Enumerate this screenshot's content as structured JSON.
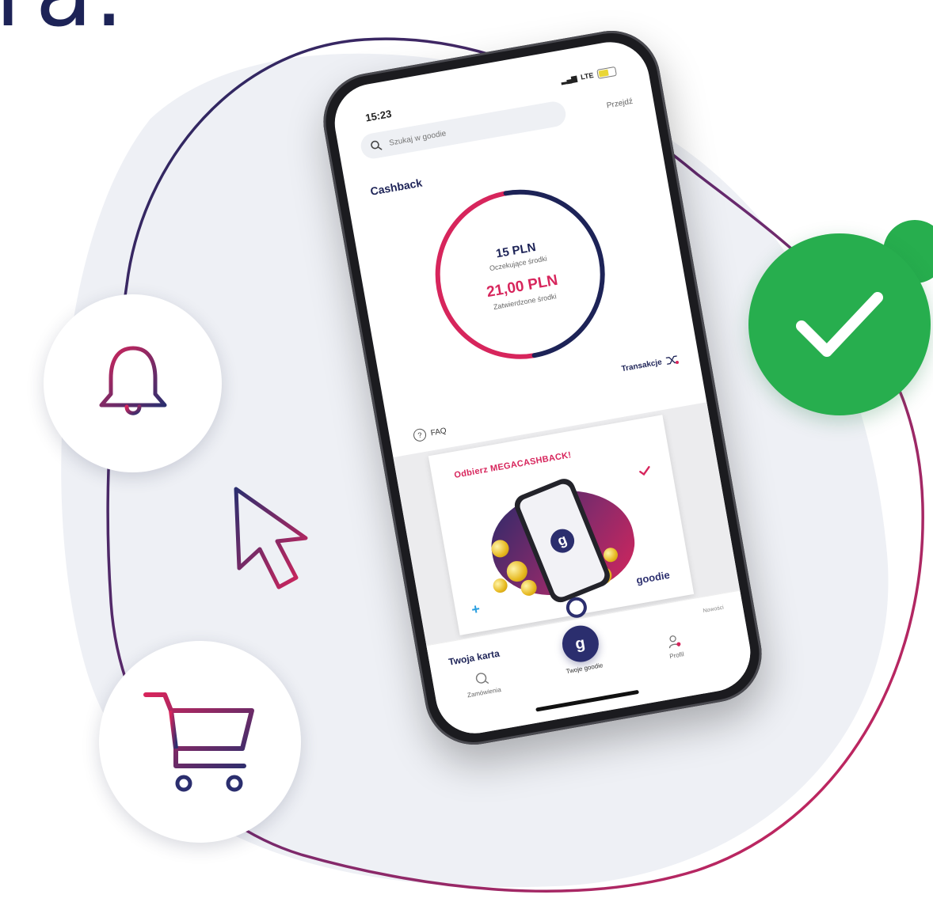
{
  "headline_fragment": "ra.",
  "colors": {
    "navy": "#1d2357",
    "crimson": "#d7255c",
    "success_green": "#27ae4e",
    "backdrop": "#eef0f5"
  },
  "icons": {
    "bell": "bell-icon",
    "cursor": "cursor-arrow-icon",
    "cart": "shopping-cart-icon",
    "check": "checkmark-icon"
  },
  "phone": {
    "status": {
      "time": "15:23",
      "network": "LTE"
    },
    "search": {
      "placeholder": "Szukaj w goodie",
      "skip_label": "Przejdź"
    },
    "cashback": {
      "title": "Cashback",
      "pending_amount": "15 PLN",
      "pending_label": "Oczekujące środki",
      "approved_amount": "21,00 PLN",
      "approved_label": "Zatwierdzone środki",
      "progress_fraction": 0.75,
      "transactions_label": "Transakcje"
    },
    "faq_label": "FAQ",
    "promo": {
      "title": "Odbierz MEGACASHBACK!",
      "subtitle": "",
      "brand": "goodie",
      "app_logo_letter": "g"
    },
    "tabbar": {
      "card_title": "Twoja karta",
      "orders_label": "Zamówienia",
      "home_label": "Twoje goodie",
      "profile_label": "Profil",
      "news_label": "Nowości"
    }
  }
}
